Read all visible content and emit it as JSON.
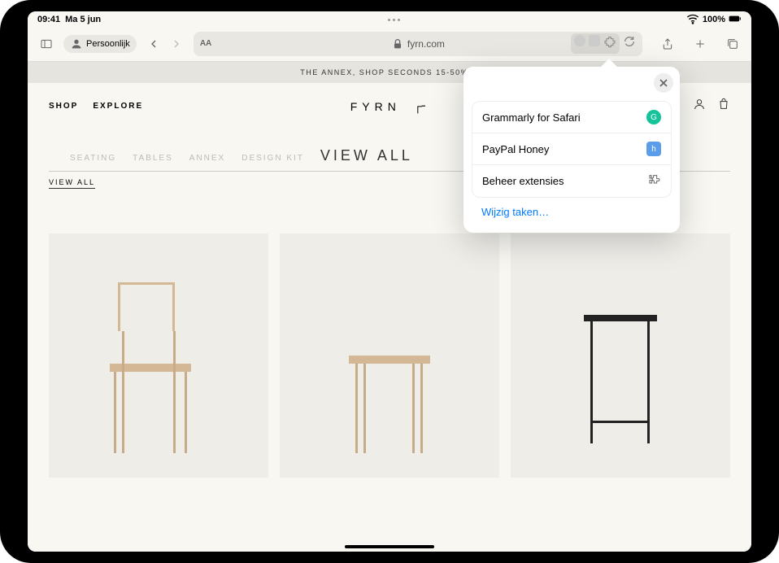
{
  "status": {
    "time": "09:41",
    "date": "Ma 5 jun",
    "battery": "100%"
  },
  "toolbar": {
    "profile_label": "Persoonlijk",
    "url": "fyrn.com"
  },
  "page": {
    "banner": "THE ANNEX, SHOP SECONDS 15-50% O",
    "nav": {
      "shop": "SHOP",
      "explore": "EXPLORE"
    },
    "brand": "FYRN",
    "brand_mark": "┌╴",
    "categories": {
      "seating": "SEATING",
      "tables": "TABLES",
      "annex": "ANNEX",
      "design_kit": "DESIGN KIT",
      "view_all": "VIEW  ALL"
    },
    "view_all_label": "VIEW ALL"
  },
  "extensions": {
    "items": [
      {
        "label": "Grammarly for Safari",
        "badge": "G"
      },
      {
        "label": "PayPal Honey",
        "badge": "h"
      }
    ],
    "manage": "Beheer extensies",
    "edit_tasks": "Wijzig taken…"
  }
}
